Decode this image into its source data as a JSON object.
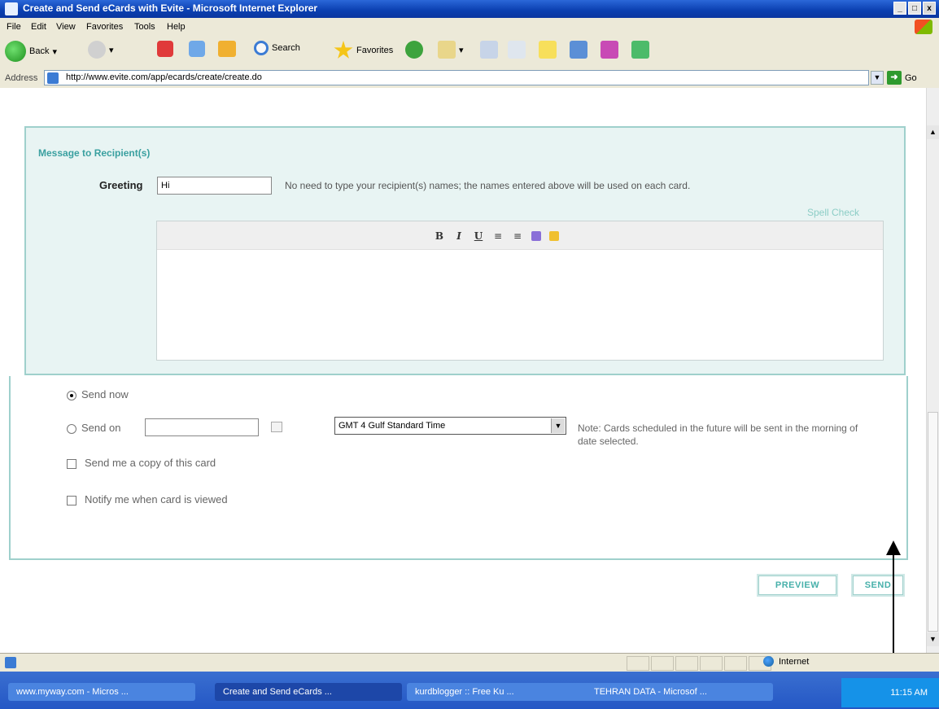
{
  "window": {
    "title": "Create and Send eCards with Evite - Microsoft Internet Explorer",
    "buttons": {
      "minimize": "_",
      "maximize": "□",
      "close": "x"
    }
  },
  "menu": [
    "File",
    "Edit",
    "View",
    "Favorites",
    "Tools",
    "Help"
  ],
  "toolbar": {
    "back": "Back",
    "search": "Search",
    "favorites": "Favorites"
  },
  "address": {
    "label": "Address",
    "url": "http://www.evite.com/app/ecards/create/create.do",
    "go": "Go"
  },
  "message": {
    "section_title": "Message to Recipient(s)",
    "greeting_label": "Greeting",
    "greeting_value": "Hi",
    "greeting_note": "No need to type your recipient(s) names; the names entered above will be used on each card.",
    "spell_check": "Spell Check",
    "editor_tools": [
      "B",
      "I",
      "U",
      "≡",
      "≡"
    ]
  },
  "options": {
    "send_now": "Send now",
    "send_on": "Send on",
    "date_value": "",
    "timezone": "GMT 4 Gulf Standard Time",
    "timezone_note": "Note: Cards scheduled in the future will be sent in the morning of date selected.",
    "copy_label": "Send me a copy of this card",
    "notify_label": "Notify me when card is viewed",
    "send_now_checked": true,
    "copy_checked": false,
    "notify_checked": false
  },
  "actions": {
    "preview": "PREVIEW",
    "send": "SEND"
  },
  "statusbar": {
    "zone": "Internet"
  },
  "taskbar": {
    "tasks": [
      "www.myway.com - Micros ...",
      "Create and Send eCards ...",
      "kurdblogger :: Free Ku ...",
      "TEHRAN DATA - Microsof ..."
    ],
    "clock": "11:15 AM"
  },
  "colors": {
    "accent": "#3aa0a0",
    "panel_bg": "#e8f4f3",
    "panel_border": "#9fd0cc",
    "titlebar": "#0a3fb0",
    "taskbar": "#2457c5"
  }
}
